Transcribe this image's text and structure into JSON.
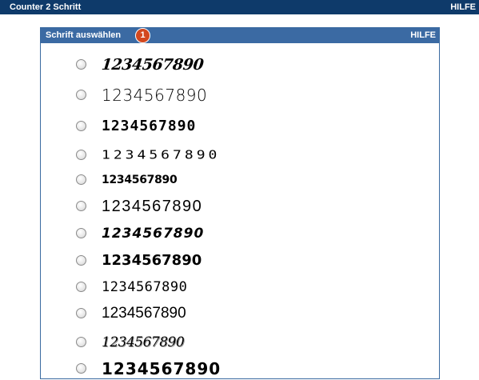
{
  "topbar": {
    "title": "Counter 2 Schritt",
    "help": "HILFE"
  },
  "panel": {
    "title": "Schrift auswählen",
    "step": "1",
    "help": "HILFE"
  },
  "font_options": [
    {
      "sample": "1234567890"
    },
    {
      "sample": "1234567890"
    },
    {
      "sample": "1234567890"
    },
    {
      "sample": "1234567890"
    },
    {
      "sample": "1234567890"
    },
    {
      "sample": "1234567890"
    },
    {
      "sample": "1234567890"
    },
    {
      "sample": "1234567890"
    },
    {
      "sample": "1234567890"
    },
    {
      "sample": "1234567890"
    },
    {
      "sample": "1234567890"
    },
    {
      "sample": "1234567890"
    }
  ]
}
